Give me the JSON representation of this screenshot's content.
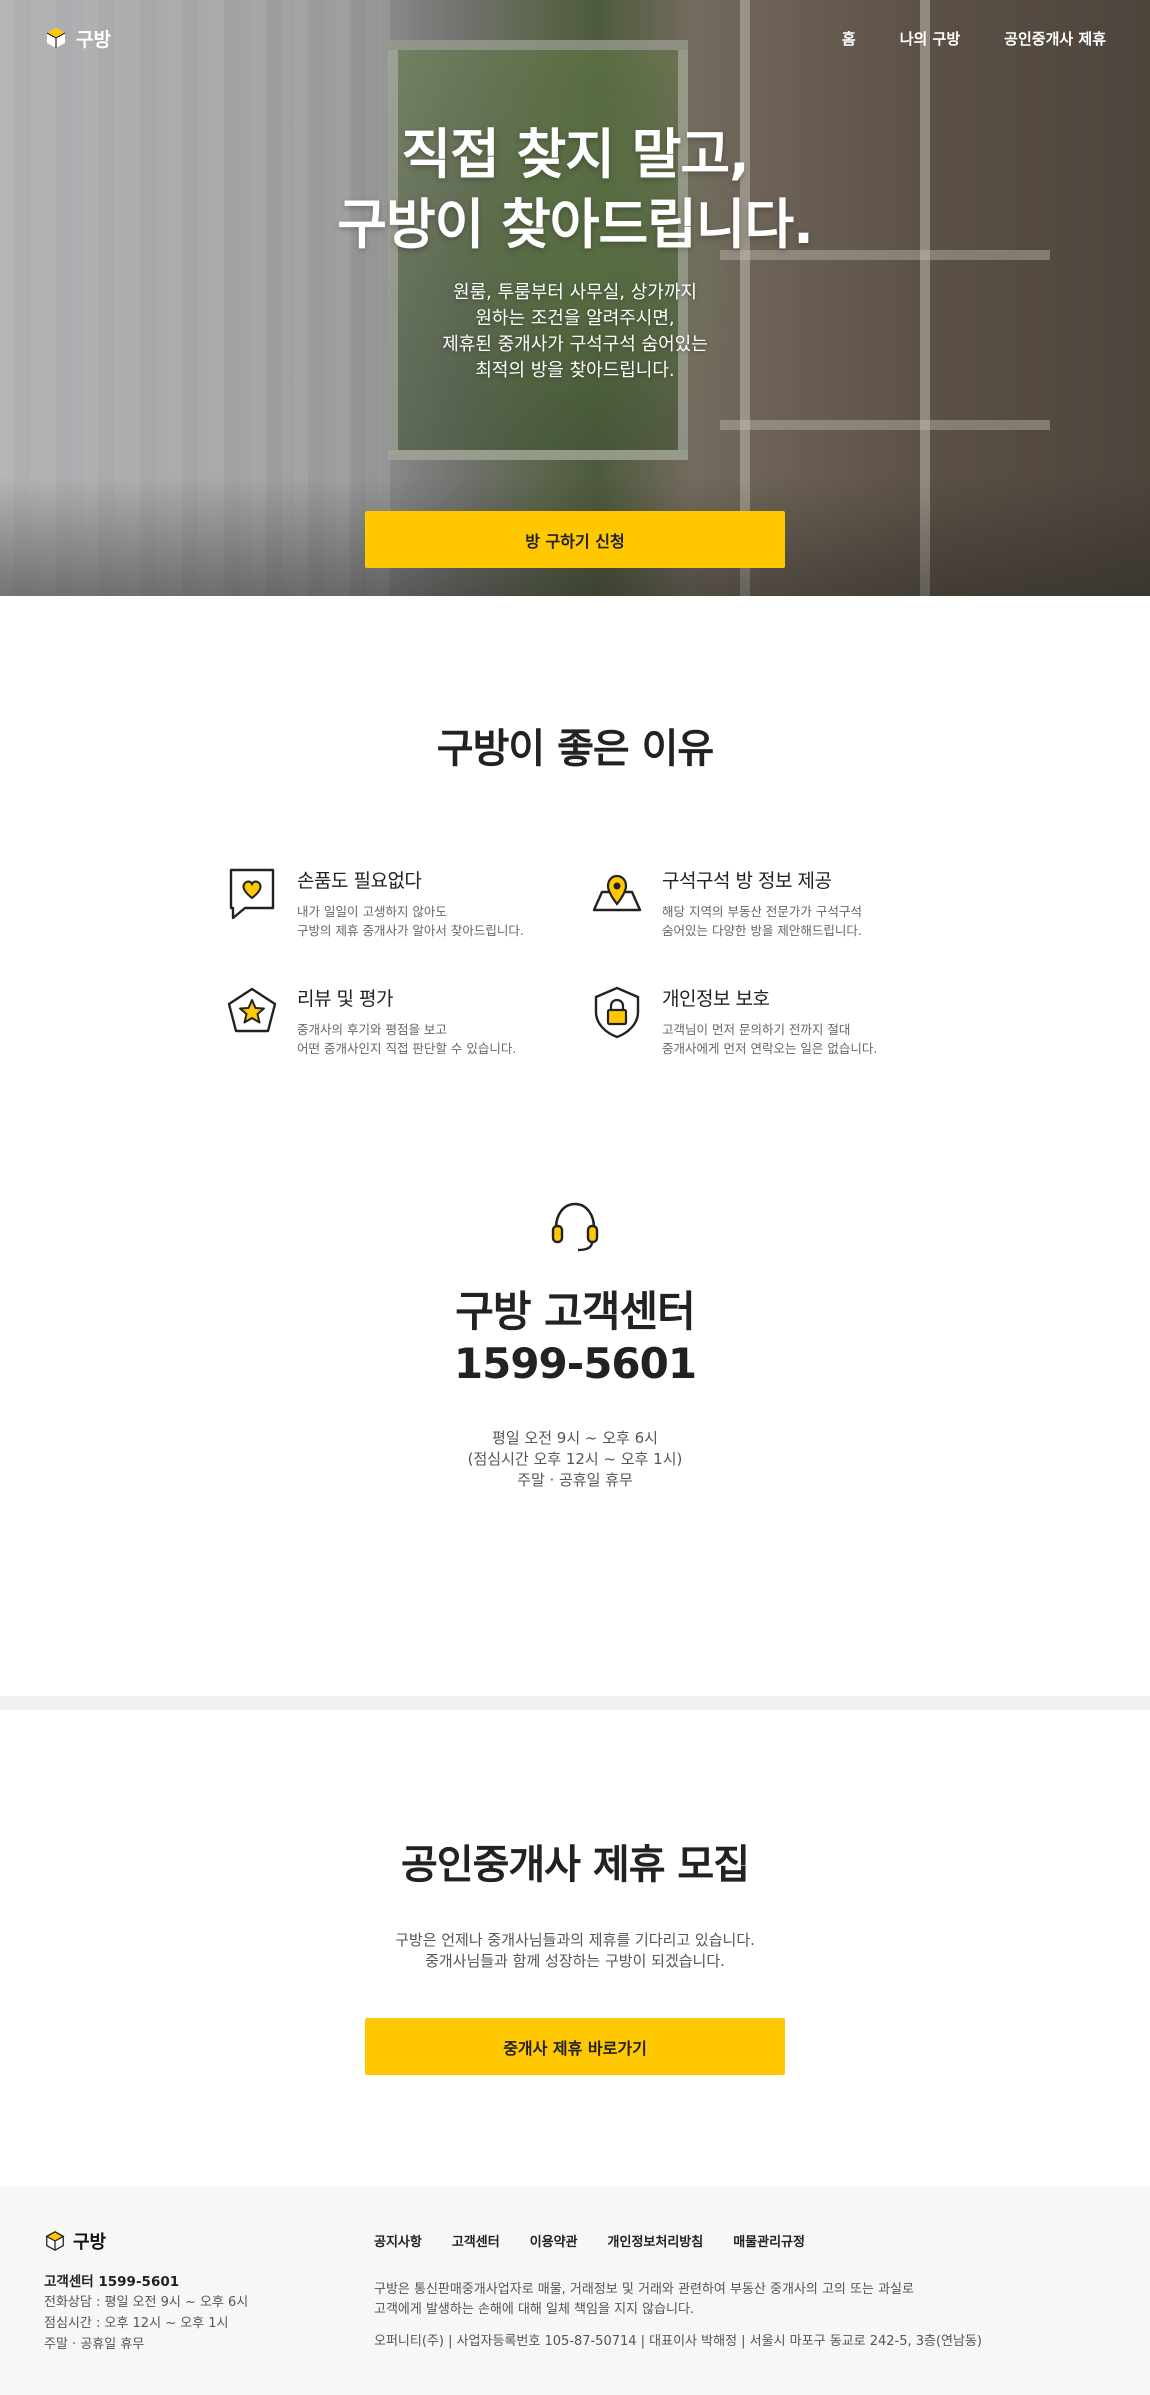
{
  "brand": {
    "name": "구방"
  },
  "nav": {
    "items": [
      "홈",
      "나의 구방",
      "공인중개사 제휴"
    ]
  },
  "hero": {
    "title_line1": "직접 찾지 말고,",
    "title_line2": "구방이 찾아드립니다.",
    "desc": [
      "원룸, 투룸부터 사무실, 상가까지",
      "원하는 조건을 알려주시면,",
      "제휴된 중개사가 구석구석 숨어있는",
      "최적의 방을 찾아드립니다."
    ],
    "cta": "방 구하기 신청"
  },
  "reasons": {
    "title": "구방이 좋은 이유",
    "items": [
      {
        "icon": "heart-chat-icon",
        "title": "손품도 필요없다",
        "desc": [
          "내가 일일이 고생하지 않아도",
          "구방의 제휴 중개사가 알아서 찾아드립니다."
        ]
      },
      {
        "icon": "map-pin-icon",
        "title": "구석구석 방 정보 제공",
        "desc": [
          "해당 지역의 부동산 전문가가 구석구석",
          "숨어있는 다양한 방을 제안해드립니다."
        ]
      },
      {
        "icon": "star-badge-icon",
        "title": "리뷰 및 평가",
        "desc": [
          "중개사의 후기와 평점을 보고",
          "어떤 중개사인지 직접 판단할 수 있습니다."
        ]
      },
      {
        "icon": "shield-lock-icon",
        "title": "개인정보 보호",
        "desc": [
          "고객님이 먼저 문의하기 전까지 절대",
          "중개사에게 먼저 연락오는 일은 없습니다."
        ]
      }
    ]
  },
  "support": {
    "title": "구방 고객센터",
    "phone": "1599-5601",
    "hours": [
      "평일 오전 9시 ~ 오후 6시",
      "(점심시간 오후 12시 ~ 오후 1시)",
      "주말 · 공휴일 휴무"
    ]
  },
  "partner": {
    "title": "공인중개사 제휴 모집",
    "desc": [
      "구방은 언제나 중개사님들과의 제휴를 기다리고 있습니다.",
      "중개사님들과 함께 성장하는 구방이 되겠습니다."
    ],
    "cta": "중개사 제휴 바로가기"
  },
  "footer": {
    "brand": "구방",
    "center": "고객센터 1599-5601",
    "detail": [
      "전화상담 : 평일 오전 9시 ~ 오후 6시",
      "점심시간 : 오후 12시 ~ 오후 1시",
      "주말 · 공휴일 휴무"
    ],
    "links": [
      "공지사항",
      "고객센터",
      "이용약관",
      "개인정보처리방침",
      "매물관리규정"
    ],
    "disclaimer": [
      "구방은 통신판매중개사업자로 매물, 거래정보 및 거래와 관련하여 부동산 중개사의 고의 또는 과실로",
      "고객에게 발생하는 손해에 대해 일체 책임을 지지 않습니다."
    ],
    "company": "오퍼니티(주) | 사업자등록번호 105-87-50714 | 대표이사 박해정 | 서울시 마포구 동교로 242-5, 3층(연남동)"
  },
  "colors": {
    "accent": "#ffc800",
    "text": "#222222",
    "muted": "#666666",
    "footer_bg": "#f7f7f7"
  }
}
